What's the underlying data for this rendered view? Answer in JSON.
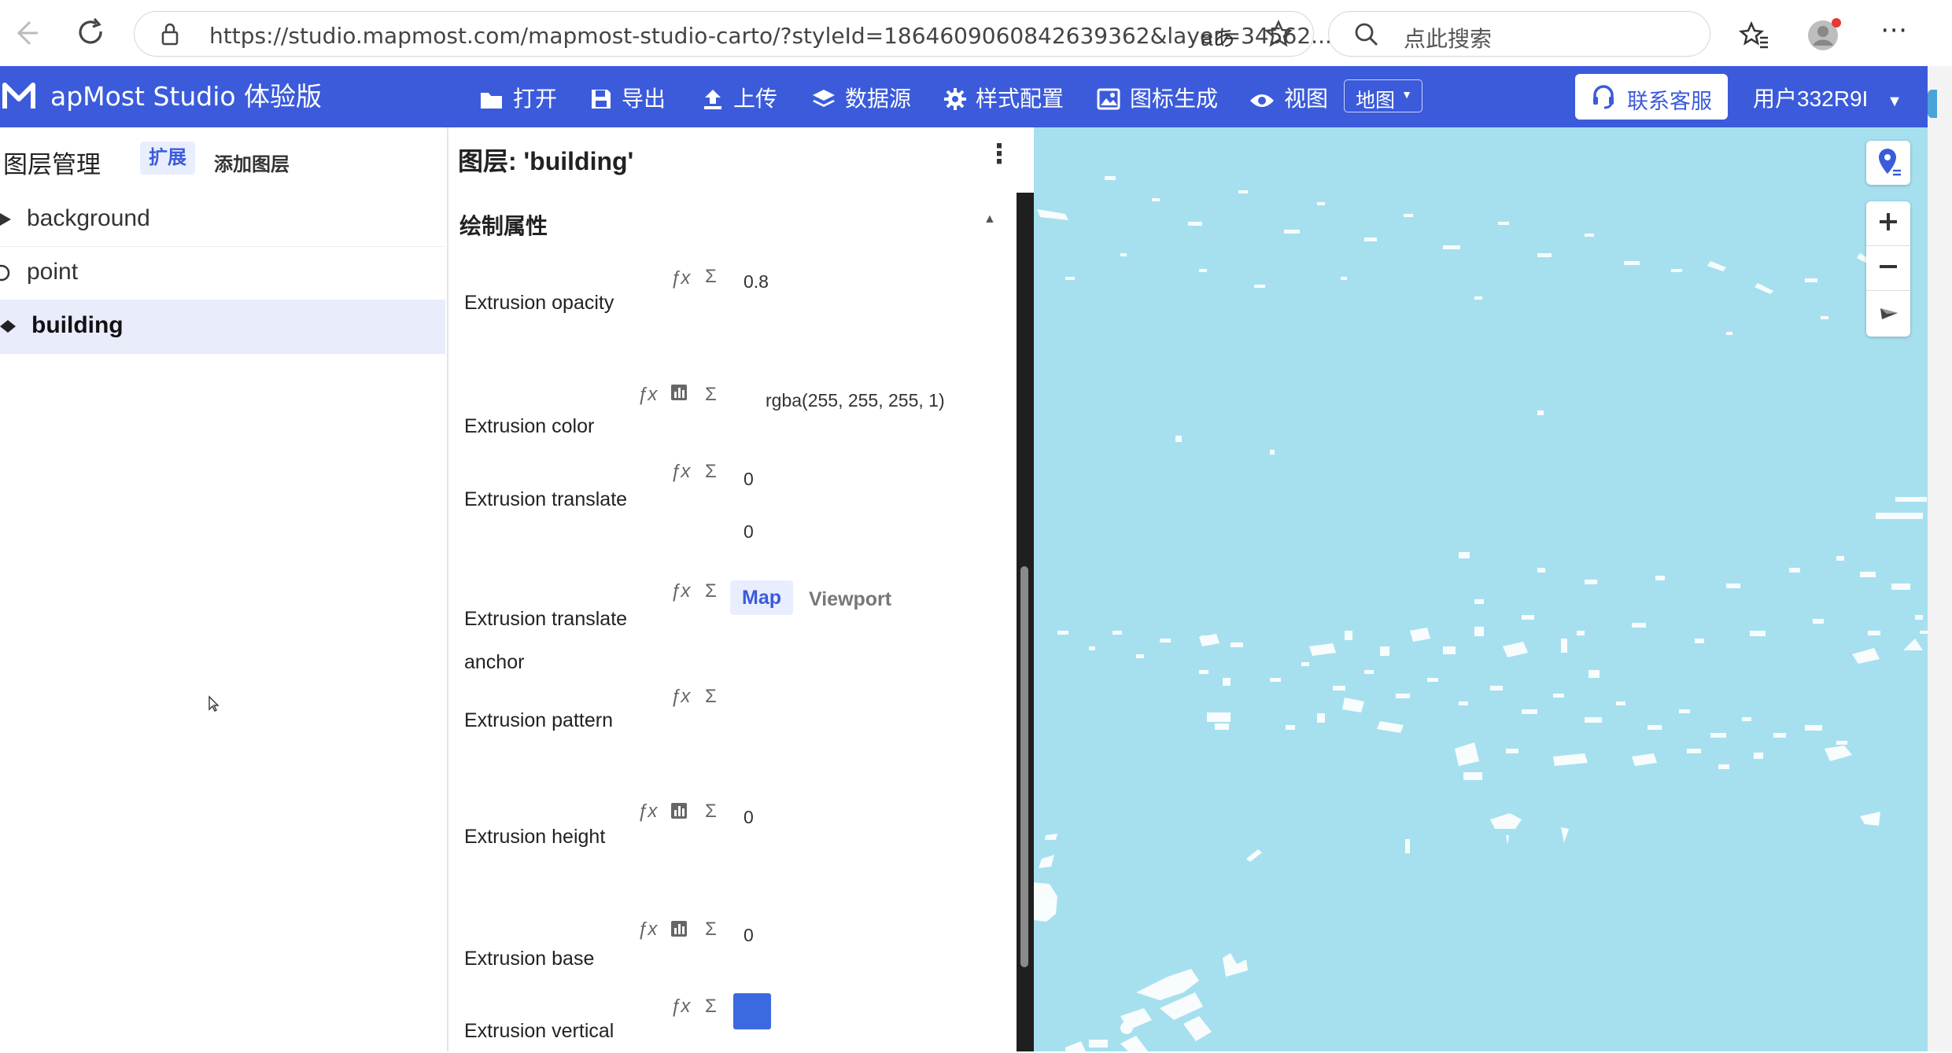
{
  "browser": {
    "url": "https://studio.mapmost.com/mapmost-studio-carto/?styleId=1864609060842639362&layer=34562...",
    "search_placeholder": "点此搜索"
  },
  "header": {
    "logo_text": "apMost  Studio 体验版",
    "menu": [
      "打开",
      "导出",
      "上传",
      "数据源",
      "样式配置",
      "图标生成",
      "视图"
    ],
    "view_select": "地图",
    "support": "联系客服",
    "user": "用户332R9I"
  },
  "layer_panel": {
    "title": "图层管理",
    "expand": "扩展",
    "add_layer": "添加图层",
    "layers": [
      "background",
      "point",
      "building"
    ]
  },
  "props": {
    "title": "图层: 'building'",
    "section": "绘制属性",
    "opacity_label": "Extrusion opacity",
    "opacity_value": "0.8",
    "color_label": "Extrusion color",
    "color_value": "rgba(255, 255, 255, 1)",
    "translate_label": "Extrusion translate",
    "translate_x": "0",
    "translate_y": "0",
    "anchor_label_1": "Extrusion translate",
    "anchor_label_2": "anchor",
    "anchor_map": "Map",
    "anchor_viewport": "Viewport",
    "pattern_label": "Extrusion pattern",
    "height_label": "Extrusion height",
    "height_value": "0",
    "base_label": "Extrusion base",
    "base_value": "0",
    "vertical_label": "Extrusion vertical",
    "gradient_color": "#3b6ae0"
  },
  "colors": {
    "accent": "#3b5bdb",
    "map_water": "#a6e0ef",
    "selected_layer": "#e9ecfb"
  }
}
